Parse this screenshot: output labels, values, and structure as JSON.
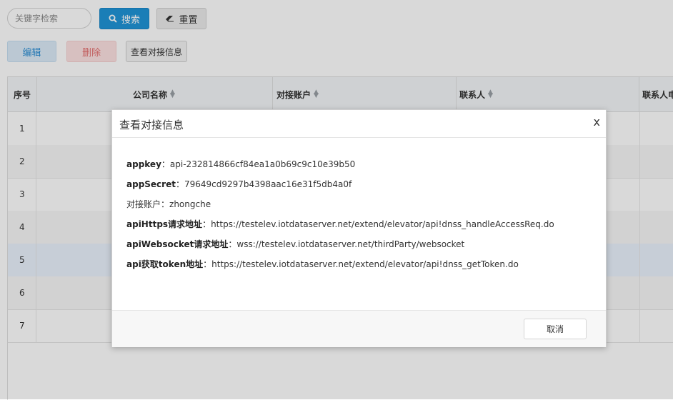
{
  "toolbar": {
    "search_placeholder": "关键字检索",
    "search_label": "搜索",
    "reset_label": "重置",
    "edit_label": "编辑",
    "delete_label": "删除",
    "view_label": "查看对接信息"
  },
  "table": {
    "columns": [
      "序号",
      "公司名称",
      "对接账户",
      "联系人",
      "联系人电"
    ],
    "rows": [
      "1",
      "2",
      "3",
      "4",
      "5",
      "6",
      "7"
    ]
  },
  "modal": {
    "title": "查看对接信息",
    "close": "x",
    "fields": [
      {
        "label": "appkey",
        "value": "api-232814866cf84ea1a0b69c9c10e39b50"
      },
      {
        "label": "appSecret",
        "value": "79649cd9297b4398aac16e31f5db4a0f"
      },
      {
        "label": "对接账户",
        "value": "zhongche"
      },
      {
        "label": "apiHttps请求地址",
        "value": "https://testelev.iotdataserver.net/extend/elevator/api!dnss_handleAccessReq.do"
      },
      {
        "label": "apiWebsocket请求地址",
        "value": "wss://testelev.iotdataserver.net/thirdParty/websocket"
      },
      {
        "label": "api获取token地址",
        "value": "https://testelev.iotdataserver.net/extend/elevator/api!dnss_getToken.do"
      }
    ],
    "separator": "：",
    "cancel_label": "取消"
  },
  "icons": {
    "search": "search-icon",
    "reset": "eraser-icon",
    "sort": "sort-icon",
    "close": "close-icon"
  },
  "colors": {
    "primary": "#1f94d8",
    "edit_bg": "#dcecf8",
    "delete_bg": "#fde2e2",
    "selected_row": "#eaf3fd"
  }
}
